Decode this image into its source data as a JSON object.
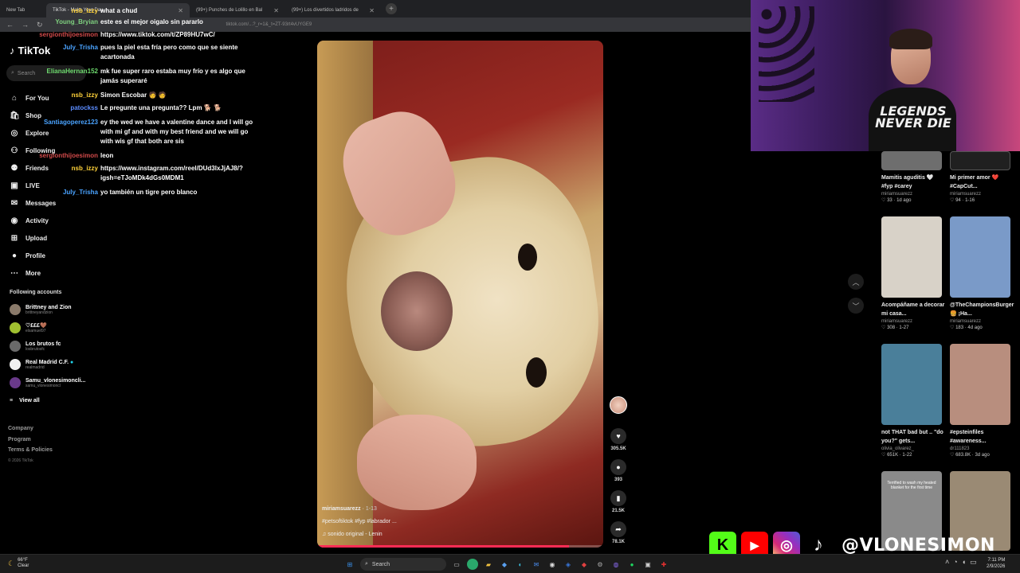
{
  "browser": {
    "tabs": [
      {
        "label": "New Tab",
        "active": false
      },
      {
        "label": "TikTok - Make Your Day",
        "active": true
      },
      {
        "label": "(99+) Punches de Lolillo en Bal",
        "active": false
      },
      {
        "label": "(99+) Los divertidos ladridos de",
        "active": false
      }
    ],
    "url": "tiktok.com/...?_r=1&_t=ZT-93rt4vUYGE9"
  },
  "tiktok": {
    "logo": "TikTok",
    "search_placeholder": "Search",
    "nav": [
      {
        "label": "For You",
        "icon": "home-icon"
      },
      {
        "label": "Shop",
        "icon": "shop-icon"
      },
      {
        "label": "Explore",
        "icon": "compass-icon"
      },
      {
        "label": "Following",
        "icon": "following-icon"
      },
      {
        "label": "Friends",
        "icon": "friends-icon"
      },
      {
        "label": "LIVE",
        "icon": "live-icon"
      },
      {
        "label": "Messages",
        "icon": "messages-icon"
      },
      {
        "label": "Activity",
        "icon": "activity-icon"
      },
      {
        "label": "Upload",
        "icon": "upload-icon"
      },
      {
        "label": "Profile",
        "icon": "profile-icon"
      },
      {
        "label": "More",
        "icon": "more-icon"
      }
    ],
    "badge": "99+",
    "following_header": "Following accounts",
    "accounts": [
      {
        "name": "Brittney and Zion",
        "handle": "brittneyandzion"
      },
      {
        "name": "♡£££🤎",
        "handle": "elsamuel97"
      },
      {
        "name": "Los brutos fc",
        "handle": "losbrutosfc"
      },
      {
        "name": "Real Madrid C.F.",
        "handle": "realmadrid"
      },
      {
        "name": "Samu_vlonesimoncli...",
        "handle": "samu_vlonesimoncl"
      }
    ],
    "view_all": "View all",
    "footer": [
      "Company",
      "Program",
      "Terms & Policies"
    ],
    "copyright": "© 2026 TikTok"
  },
  "chat": [
    {
      "user": "Young_Bryian",
      "color": "#7fd17f",
      "text": "este es el mejor oigalo sin pararlo"
    },
    {
      "user": "sergionthijoesimon",
      "color": "#d24a4a",
      "text": "https://www.tiktok.com/t/ZP89HU7wC/"
    },
    {
      "user": "July_Trisha",
      "color": "#4aa3ff",
      "text": "pues la piel esta fría pero como que se siente acartonada"
    },
    {
      "user": "ElianaHernan152",
      "color": "#6fdc6f",
      "text": "mk fue super raro estaba muy frío y es algo que jamás superaré"
    },
    {
      "user": "nsb_izzy",
      "color": "#ffd23a",
      "text": "Simon Escobar 🧑 🧑"
    },
    {
      "user": "patockss",
      "color": "#5b8cff",
      "text": "Le pregunte una pregunta?? Lpm 🐕 🐕"
    },
    {
      "user": "Santiagoperez123",
      "color": "#4aa3ff",
      "text": "ey the wed we have a valentine dance and I will go with mi gf and with my best friend and we will go with wis gf that both are sis"
    },
    {
      "user": "sergionthijoesimon",
      "color": "#d24a4a",
      "text": "leon"
    },
    {
      "user": "nsb_izzy",
      "color": "#ffd23a",
      "text": "https://www.instagram.com/reel/DUd3lxJjAJ8/?igsh=eTJoMDk4dGs0MDM1"
    },
    {
      "user": "July_Trisha",
      "color": "#4aa3ff",
      "text": "yo también un tigre pero blanco"
    }
  ],
  "top_chat": {
    "user": "nsb_izzy",
    "text": "what a chud"
  },
  "video": {
    "creator": "miriamsuarezz",
    "date": "1-13",
    "caption": "#petsoftiktok #fyp #labrador ...",
    "sound": "sonido original - Lenin",
    "progress": 0.88
  },
  "actions": [
    {
      "name": "like",
      "icon": "heart-icon",
      "count": "305.5K"
    },
    {
      "name": "comment",
      "icon": "comment-icon",
      "count": "393"
    },
    {
      "name": "save",
      "icon": "bookmark-icon",
      "count": "21.5K"
    },
    {
      "name": "share",
      "icon": "share-icon",
      "count": "78.1K"
    }
  ],
  "feed": [
    {
      "title": "Mamitis aguditis 🤍 #fyp #carey",
      "author": "miriamsuarezz",
      "likes": "33",
      "date": "1d ago",
      "color": "#6e6e6e"
    },
    {
      "title": "Mi primer amor ❤️ #CapCut...",
      "author": "miriamsuarezz",
      "likes": "94",
      "date": "1-16",
      "color": "#202020"
    },
    {
      "title": "Acompáñame a decorar mi casa...",
      "author": "miriamsuarezz",
      "likes": "308",
      "date": "1-27",
      "color": "#d8d2c8"
    },
    {
      "title": "@TheChampionsBurger 🍔 ¡Ha...",
      "author": "miriamsuarezz",
      "likes": "183",
      "date": "4d ago",
      "color": "#7a9ac8"
    },
    {
      "title": "not THAT bad but .. \"do you?\" gets...",
      "author": "olivia_olivarez_",
      "likes": "651K",
      "date": "1-22",
      "color": "#4a7f9a"
    },
    {
      "title": "#epsteinfiles #awareness...",
      "author": "dr111823",
      "likes": "683.8K",
      "date": "3d ago",
      "color": "#b88e7e"
    },
    {
      "title": "Terrified to wash my heated blanket for the first time",
      "author": "",
      "likes": "",
      "date": "",
      "color": "#8a8a8a"
    },
    {
      "title": "",
      "author": "",
      "likes": "",
      "date": "",
      "color": "#9a8a74"
    }
  ],
  "webcam": {
    "shirt_text": "LEGENDS NEVER DIE"
  },
  "overlay": {
    "handle": "@VLONESIMON"
  },
  "taskbar": {
    "temp": "66°F",
    "weather": "Clear",
    "search": "Search",
    "time": "7:11 PM",
    "date": "2/9/2026"
  }
}
